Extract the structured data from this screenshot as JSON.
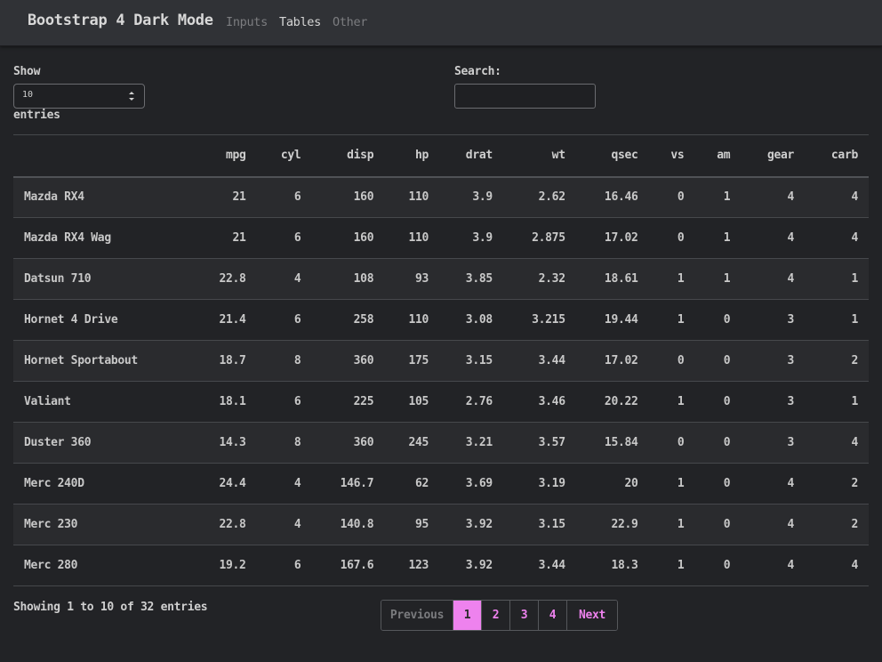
{
  "navbar": {
    "brand": "Bootstrap 4 Dark Mode",
    "links": [
      "Inputs",
      "Tables",
      "Other"
    ],
    "active": "Tables"
  },
  "controls": {
    "show_label": "Show",
    "page_length": "10",
    "entries_label": "entries",
    "search_label": "Search:",
    "search_value": ""
  },
  "table": {
    "columns": [
      "",
      "mpg",
      "cyl",
      "disp",
      "hp",
      "drat",
      "wt",
      "qsec",
      "vs",
      "am",
      "gear",
      "carb"
    ],
    "rows": [
      [
        "Mazda RX4",
        "21",
        "6",
        "160",
        "110",
        "3.9",
        "2.62",
        "16.46",
        "0",
        "1",
        "4",
        "4"
      ],
      [
        "Mazda RX4 Wag",
        "21",
        "6",
        "160",
        "110",
        "3.9",
        "2.875",
        "17.02",
        "0",
        "1",
        "4",
        "4"
      ],
      [
        "Datsun 710",
        "22.8",
        "4",
        "108",
        "93",
        "3.85",
        "2.32",
        "18.61",
        "1",
        "1",
        "4",
        "1"
      ],
      [
        "Hornet 4 Drive",
        "21.4",
        "6",
        "258",
        "110",
        "3.08",
        "3.215",
        "19.44",
        "1",
        "0",
        "3",
        "1"
      ],
      [
        "Hornet Sportabout",
        "18.7",
        "8",
        "360",
        "175",
        "3.15",
        "3.44",
        "17.02",
        "0",
        "0",
        "3",
        "2"
      ],
      [
        "Valiant",
        "18.1",
        "6",
        "225",
        "105",
        "2.76",
        "3.46",
        "20.22",
        "1",
        "0",
        "3",
        "1"
      ],
      [
        "Duster 360",
        "14.3",
        "8",
        "360",
        "245",
        "3.21",
        "3.57",
        "15.84",
        "0",
        "0",
        "3",
        "4"
      ],
      [
        "Merc 240D",
        "24.4",
        "4",
        "146.7",
        "62",
        "3.69",
        "3.19",
        "20",
        "1",
        "0",
        "4",
        "2"
      ],
      [
        "Merc 230",
        "22.8",
        "4",
        "140.8",
        "95",
        "3.92",
        "3.15",
        "22.9",
        "1",
        "0",
        "4",
        "2"
      ],
      [
        "Merc 280",
        "19.2",
        "6",
        "167.6",
        "123",
        "3.92",
        "3.44",
        "18.3",
        "1",
        "0",
        "4",
        "4"
      ]
    ]
  },
  "footer": {
    "info": "Showing 1 to 10 of 32 entries",
    "previous": "Previous",
    "pages": [
      "1",
      "2",
      "3",
      "4"
    ],
    "current_page": "1",
    "next": "Next"
  },
  "colors": {
    "accent": "#ee82ee",
    "background": "#222326",
    "navbar": "#303236"
  }
}
